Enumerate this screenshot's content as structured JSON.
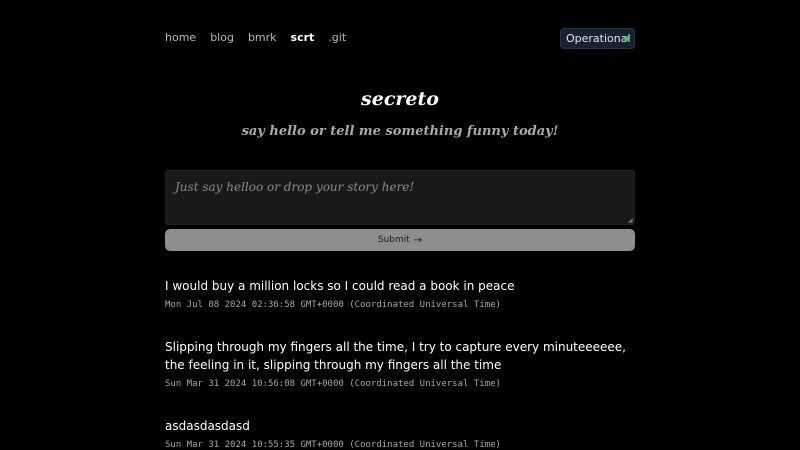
{
  "nav": {
    "items": [
      {
        "label": "home",
        "active": false
      },
      {
        "label": "blog",
        "active": false
      },
      {
        "label": "bmrk",
        "active": false
      },
      {
        "label": "scrt",
        "active": true
      },
      {
        "label": ".git",
        "active": false
      }
    ]
  },
  "status": {
    "label": "Operational",
    "color": "#3ec46d"
  },
  "header": {
    "title": "secreto",
    "subtitle": "say hello or tell me something funny today!"
  },
  "form": {
    "placeholder": "Just say helloo or drop your story here!",
    "value": "",
    "submit_label": "Submit",
    "submit_icon": "arrow-right-icon"
  },
  "entries": [
    {
      "message": "I would buy a million locks so I could read a book in peace",
      "timestamp": "Mon Jul 08 2024 02:36:58 GMT+0000 (Coordinated Universal Time)"
    },
    {
      "message": "Slipping through my fingers all the time, I try to capture every minuteeeeee, the feeling in it, slipping through my fingers all the time",
      "timestamp": "Sun Mar 31 2024 10:56:08 GMT+0000 (Coordinated Universal Time)"
    },
    {
      "message": "asdasdasdasd",
      "timestamp": "Sun Mar 31 2024 10:55:35 GMT+0000 (Coordinated Universal Time)"
    }
  ]
}
